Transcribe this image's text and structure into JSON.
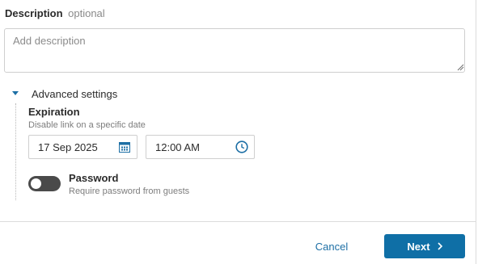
{
  "description": {
    "label": "Description",
    "optional_text": "optional",
    "placeholder": "Add description",
    "value": ""
  },
  "advanced": {
    "label": "Advanced settings",
    "expanded": true,
    "caret_icon": "caret-down-icon"
  },
  "expiration": {
    "title": "Expiration",
    "subtitle": "Disable link on a specific date",
    "date_value": "17 Sep 2025",
    "date_icon": "calendar-icon",
    "time_value": "12:00 AM",
    "time_icon": "clock-icon"
  },
  "password": {
    "title": "Password",
    "subtitle": "Require password from guests",
    "enabled": false
  },
  "footer": {
    "cancel_label": "Cancel",
    "next_label": "Next",
    "next_icon": "chevron-right-icon"
  },
  "colors": {
    "primary": "#0f6fa6",
    "link": "#1d6fa5",
    "toggle_off": "#4a4a4a"
  }
}
